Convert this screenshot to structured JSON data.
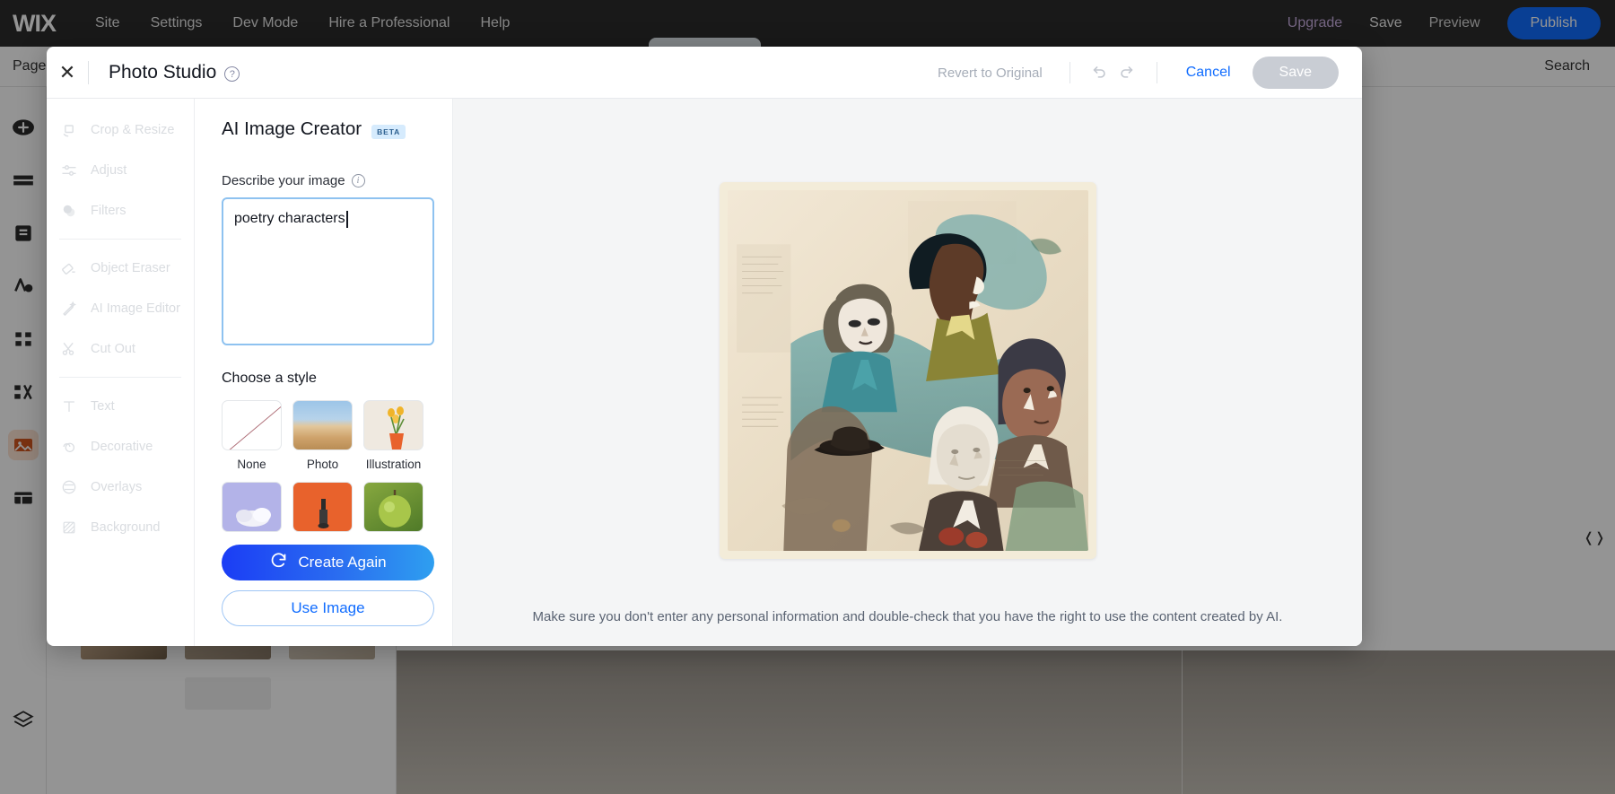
{
  "background": {
    "logo": "WIX",
    "topnav": [
      "Site",
      "Settings",
      "Dev Mode",
      "Hire a Professional",
      "Help"
    ],
    "upgrade": "Upgrade",
    "save": "Save",
    "preview": "Preview",
    "publish": "Publish",
    "pages": "Pages",
    "search": "Search",
    "publish_color": "#116dff",
    "upgrade_color": "#c9aee0",
    "rail_icons": [
      "add-icon",
      "sections-icon",
      "pages-icon",
      "theme-icon",
      "apps-icon",
      "marketing-icon",
      "media-icon",
      "content-manager-icon"
    ],
    "rail_active_index": 6,
    "layers_icon": "layers-icon"
  },
  "modal": {
    "close_icon": "close-icon",
    "title": "Photo Studio",
    "help_icon": "help-icon",
    "revert": "Revert to Original",
    "undo_icon": "undo-icon",
    "redo_icon": "redo-icon",
    "cancel": "Cancel",
    "save": "Save",
    "save_disabled": true
  },
  "tools": {
    "groups": [
      [
        {
          "label": "Crop & Resize",
          "icon": "crop-resize-icon"
        },
        {
          "label": "Adjust",
          "icon": "adjust-sliders-icon"
        },
        {
          "label": "Filters",
          "icon": "filters-icon"
        }
      ],
      [
        {
          "label": "Object Eraser",
          "icon": "eraser-icon"
        },
        {
          "label": "AI Image Editor",
          "icon": "magic-wand-icon"
        },
        {
          "label": "Cut Out",
          "icon": "scissors-icon"
        }
      ],
      [
        {
          "label": "Text",
          "icon": "text-icon"
        },
        {
          "label": "Decorative",
          "icon": "decorative-icon"
        },
        {
          "label": "Overlays",
          "icon": "overlays-icon"
        },
        {
          "label": "Background",
          "icon": "background-icon"
        }
      ]
    ]
  },
  "creator": {
    "title": "AI Image Creator",
    "beta": "BETA",
    "describe_label": "Describe your image",
    "info_icon": "info-icon",
    "prompt_value": "poetry characters",
    "prompt_placeholder": "Describe your image",
    "style_label": "Choose a style",
    "styles": [
      {
        "name": "None",
        "thumb": "none-thumb",
        "selected": false
      },
      {
        "name": "Photo",
        "thumb": "photo-thumb",
        "selected": false
      },
      {
        "name": "Illustration",
        "thumb": "illus-thumb",
        "selected": false
      },
      {
        "name": "",
        "thumb": "paint-thumb",
        "selected": false
      },
      {
        "name": "",
        "thumb": "three-thumb",
        "selected": false
      },
      {
        "name": "",
        "thumb": "real-thumb",
        "selected": false
      }
    ],
    "create_again": "Create Again",
    "create_again_icon": "refresh-icon",
    "use_image": "Use Image"
  },
  "preview": {
    "image_alt": "AI generated collage of portrait figures over vintage paper",
    "disclaimer": "Make sure you don't enter any personal information and double-check that you have the right to use the content created by AI."
  }
}
